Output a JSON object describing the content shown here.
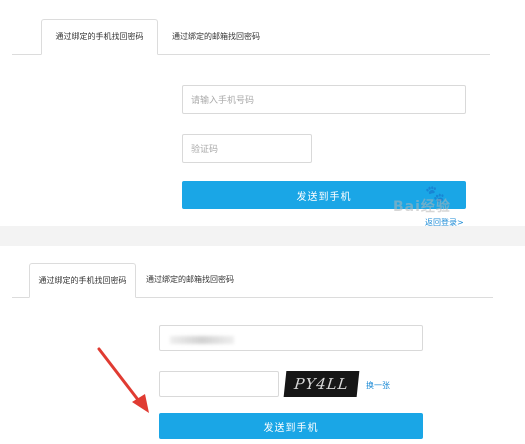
{
  "top_panel": {
    "tabs": [
      {
        "label": "通过绑定的手机找回密码",
        "active": true
      },
      {
        "label": "通过绑定的邮箱找回密码",
        "active": false
      }
    ],
    "phone_placeholder": "请输入手机号码",
    "code_placeholder": "验证码",
    "send_button": "发送到手机",
    "back_link": "返回登录>"
  },
  "bottom_panel": {
    "tabs": [
      {
        "label": "通过绑定的手机找回密码",
        "active": true
      },
      {
        "label": "通过绑定的邮箱找回密码",
        "active": false
      }
    ],
    "code_placeholder": "",
    "captcha_text": "PY4LL",
    "refresh_link": "换一张",
    "send_button": "发送到手机"
  },
  "watermark": {
    "text": "Bai经验",
    "paw": "🐾"
  },
  "colors": {
    "primary_button": "#1aa6e6",
    "link": "#1a8ad6",
    "arrow": "#e03b32",
    "border": "#d9d9d9"
  }
}
